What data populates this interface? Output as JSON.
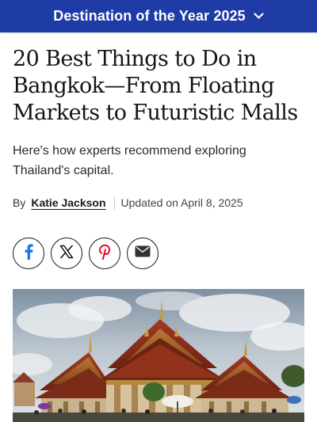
{
  "banner": {
    "label": "Destination of the Year 2025",
    "icon": "chevron-down-icon",
    "background": "#1f3ba5"
  },
  "article": {
    "headline": "20 Best Things to Do in Bangkok—From Floating Markets to Futuristic Malls",
    "dek": "Here's how experts recommend exploring Thailand's capital.",
    "byline_prefix": "By",
    "author": "Katie Jackson",
    "updated": "Updated on April 8, 2025"
  },
  "share": [
    {
      "icon": "facebook-icon",
      "color": "#1877f2"
    },
    {
      "icon": "x-icon",
      "color": "#111111"
    },
    {
      "icon": "pinterest-icon",
      "color": "#e60023"
    },
    {
      "icon": "email-icon",
      "color": "#333333"
    }
  ],
  "hero_image": {
    "subject": "temple-photo"
  }
}
